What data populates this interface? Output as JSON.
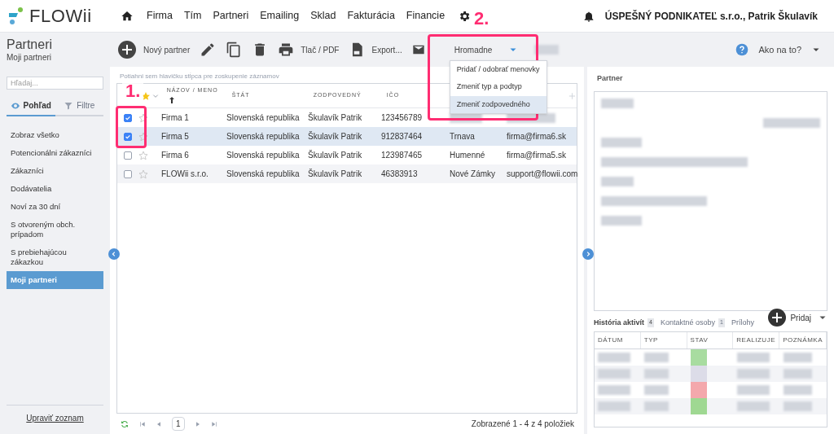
{
  "brand": {
    "name": "FLOWii"
  },
  "nav": [
    {
      "label": "Firma"
    },
    {
      "label": "Tím"
    },
    {
      "label": "Partneri"
    },
    {
      "label": "Emailing"
    },
    {
      "label": "Sklad"
    },
    {
      "label": "Fakturácia"
    },
    {
      "label": "Financie"
    }
  ],
  "user": "ÚSPEŠNÝ PODNIKATEĽ s.r.o., Patrik Škulavík",
  "annotations": [
    {
      "label": "1."
    },
    {
      "label": "2."
    }
  ],
  "page": {
    "title": "Partneri",
    "subtitle": "Moji partneri"
  },
  "toolbar": [
    {
      "kind": "add",
      "label": "Nový partner"
    },
    {
      "kind": "edit"
    },
    {
      "kind": "copy"
    },
    {
      "kind": "delete"
    },
    {
      "kind": "print",
      "label": "Tlač / PDF"
    },
    {
      "kind": "export",
      "label": "Export..."
    },
    {
      "kind": "mail"
    }
  ],
  "bulk": {
    "label": "Hromadne",
    "expanded": true,
    "options": [
      {
        "label": "Pridať / odobrať menovky",
        "selected": false
      },
      {
        "label": "Zmeniť typ a podtyp",
        "selected": false
      },
      {
        "label": "Zmeniť zodpovedného",
        "selected": true
      }
    ]
  },
  "help": {
    "label": "Ako na to?"
  },
  "sidebar": {
    "search": {
      "placeholder": "Hľadaj..."
    },
    "tabs": [
      {
        "label": "Pohľad",
        "selected": true
      },
      {
        "label": "Filtre",
        "selected": false
      }
    ],
    "items": [
      {
        "label": "Zobraz všetko",
        "selected": false
      },
      {
        "label": "Potencionálni zákazníci",
        "selected": false
      },
      {
        "label": "Zákazníci",
        "selected": false
      },
      {
        "label": "Dodávatelia",
        "selected": false
      },
      {
        "label": "Noví za 30 dní",
        "selected": false
      },
      {
        "label": "S otvoreným obch. prípadom",
        "selected": false
      },
      {
        "label": "S prebiehajúcou zákazkou",
        "selected": false
      },
      {
        "label": "Moji partneri",
        "selected": true
      }
    ],
    "footer_link": "Upraviť zoznam"
  },
  "grid": {
    "group_hint": "Potiahni sem hlavičku stĺpca pre zoskupenie záznamov",
    "columns": [
      {
        "label": "NÁZOV / MENO",
        "sorted": true
      },
      {
        "label": "ŠTÁT",
        "sorted": false
      },
      {
        "label": "ZODPOVEDNÝ",
        "sorted": false
      },
      {
        "label": "IČO",
        "sorted": false
      }
    ],
    "rows": [
      {
        "checked": true,
        "starred": false,
        "selected": false,
        "name": "Firma 1",
        "state": "Slovenská republika",
        "owner": "Škulavík Patrik",
        "ico": "123456789"
      },
      {
        "checked": true,
        "starred": false,
        "selected": true,
        "name": "Firma 5",
        "state": "Slovenská republika",
        "owner": "Škulavík Patrik",
        "ico": "912837464",
        "city": "Trnava",
        "email": "firma@firma6.sk"
      },
      {
        "checked": false,
        "starred": false,
        "selected": false,
        "name": "Firma 6",
        "state": "Slovenská republika",
        "owner": "Škulavík Patrik",
        "ico": "123987465",
        "city": "Humenné",
        "email": "firma@firma5.sk"
      },
      {
        "checked": false,
        "starred": false,
        "selected": false,
        "name": "FLOWii s.r.o.",
        "state": "Slovenská republika",
        "owner": "Škulavík Patrik",
        "ico": "46383913",
        "city": "Nové Zámky",
        "email": "support@flowii.com"
      }
    ],
    "pager": {
      "page": "1",
      "summary": "Zobrazené 1 - 4 z 4 položiek"
    }
  },
  "detail": {
    "title": "Partner",
    "tabs": [
      {
        "label": "História aktivít",
        "count": "4",
        "selected": true
      },
      {
        "label": "Kontaktné osoby",
        "count": "1",
        "selected": false
      },
      {
        "label": "Prílohy",
        "selected": false
      }
    ],
    "add_label": "Pridaj",
    "columns": [
      "DÁTUM",
      "TYP",
      "STAV",
      "REALIZUJE",
      "POZNÁMKA"
    ],
    "activities": [
      {
        "color": "#a8dca0"
      },
      {
        "color": "#dcdce8"
      },
      {
        "color": "#f4a8ac"
      },
      {
        "color": "#9fd892"
      }
    ]
  }
}
